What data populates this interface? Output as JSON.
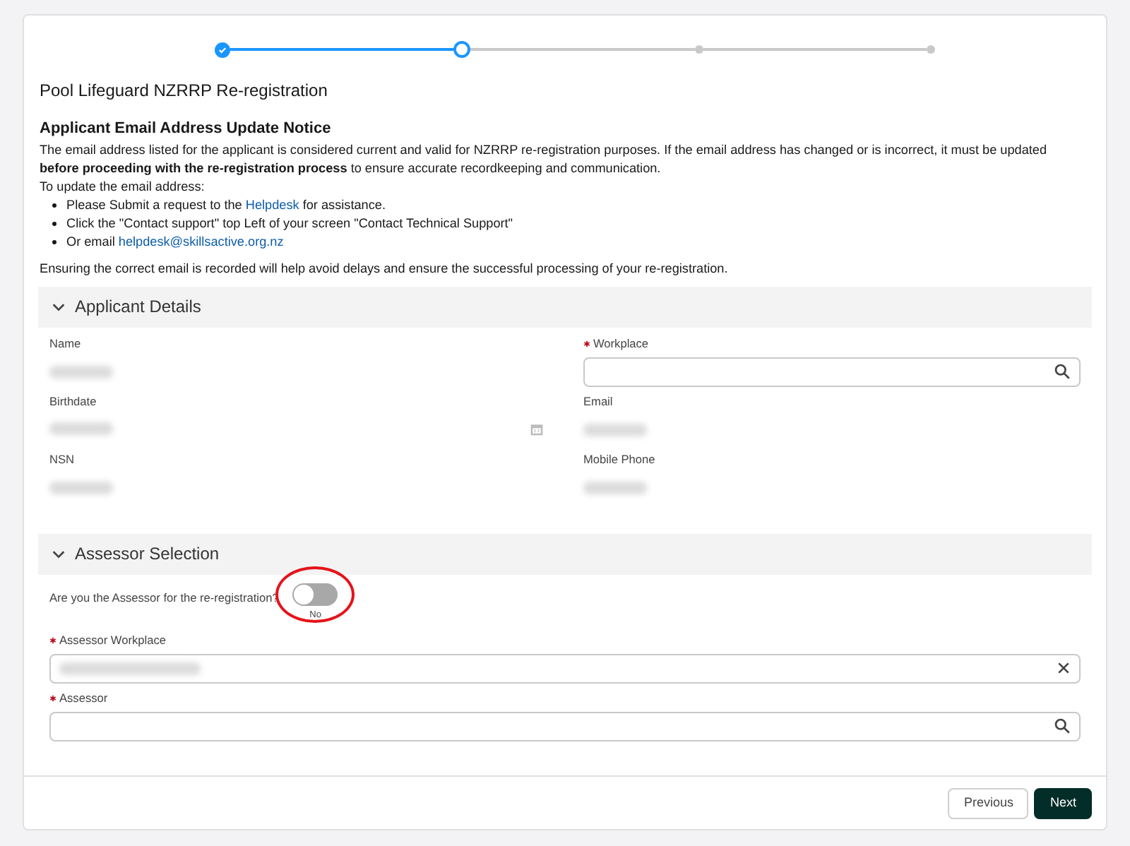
{
  "stepper": [
    {
      "complete": true,
      "current": false
    },
    {
      "complete": false,
      "current": true
    },
    {
      "complete": false,
      "current": false
    },
    {
      "complete": false,
      "current": false
    }
  ],
  "title": "Pool Lifeguard NZRRP Re-registration",
  "notice": {
    "heading": "Applicant Email Address Update Notice",
    "paragraph": "The email address listed for the applicant is considered current and valid for NZRRP re-registration purposes. If the email address has changed or is incorrect, it must be updated **before proceeding with the re-registration process** to ensure accurate recordkeeping and communication.",
    "intro": "To update the email address:",
    "bullets": [
      {
        "before": "Please Submit a request to the ",
        "link": "Helpdesk",
        "after": " for assistance."
      },
      {
        "before": "Click the \"Contact support\" top Left of your screen \"Contact Technical Support\""
      },
      {
        "before": "Or email ",
        "link": "helpdesk@skillsactive.org.nz"
      }
    ],
    "closing": "Ensuring the correct email is recorded will help avoid delays and ensure the successful processing of your re-registration."
  },
  "applicant_details": {
    "heading": "Applicant Details",
    "expanded": true,
    "fields": [
      {
        "label": "Name",
        "kind": "readonly",
        "required": false,
        "blurred": true
      },
      {
        "label": "Workplace",
        "kind": "lookup",
        "required": true
      },
      {
        "label": "Birthdate",
        "kind": "date",
        "required": false,
        "blurred": true
      },
      {
        "label": "Email",
        "kind": "readonly",
        "required": false,
        "blurred": true
      },
      {
        "label": "NSN",
        "kind": "readonly",
        "required": false,
        "blurred": true
      },
      {
        "label": "Mobile Phone",
        "kind": "readonly",
        "required": false,
        "blurred": true
      }
    ]
  },
  "assessor_selection": {
    "heading": "Assessor Selection",
    "expanded": true,
    "toggle": {
      "label": "Are you the Assessor for the re-registration?",
      "on": false,
      "state_text": "No",
      "annotated": true
    },
    "fields": [
      {
        "label": "Assessor Workplace",
        "kind": "clearable",
        "required": true,
        "blurred": true
      },
      {
        "label": "Assessor",
        "kind": "lookup",
        "required": true
      }
    ]
  },
  "buttons": [
    {
      "label": "Previous",
      "kind": "secondary"
    },
    {
      "label": "Next",
      "kind": "primary"
    }
  ]
}
